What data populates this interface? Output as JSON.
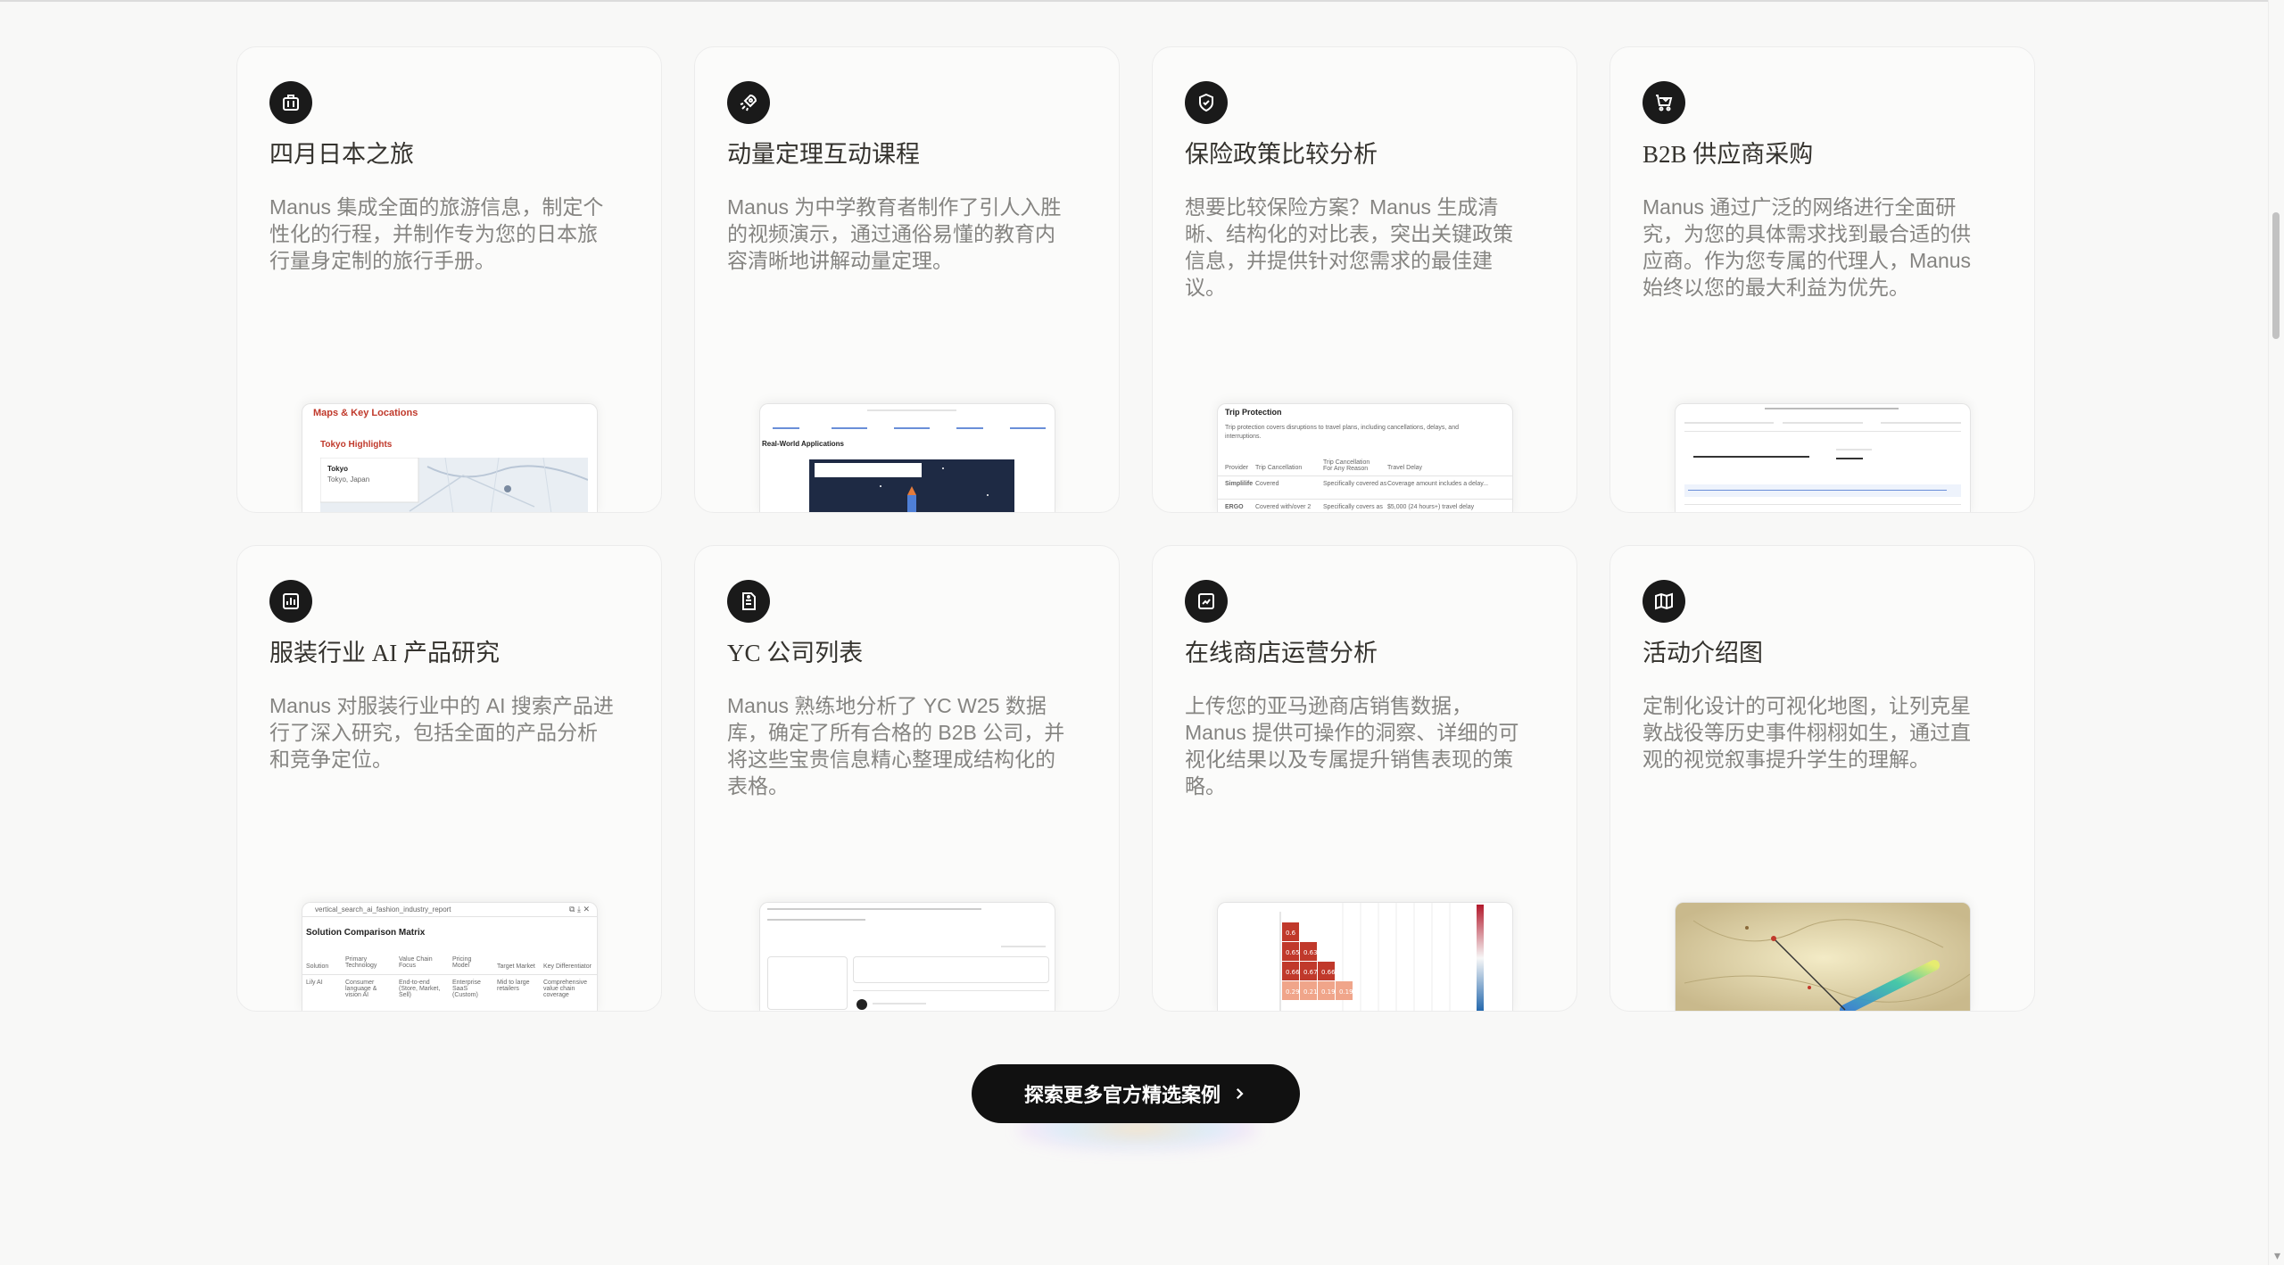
{
  "cards": [
    {
      "icon": "suitcase-icon",
      "title": "四月日本之旅",
      "desc": "Manus 集成全面的旅游信息，制定个性化的行程，并制作专为您的日本旅行量身定制的旅行手册。",
      "preview": {
        "heading": "Maps & Key Locations",
        "sub": "Tokyo Highlights",
        "place": "Tokyo",
        "place_sub": "Tokyo, Japan"
      }
    },
    {
      "icon": "rocket-icon",
      "title": "动量定理互动课程",
      "desc": "Manus 为中学教育者制作了引人入胜的视频演示，通过通俗易懂的教育内容清晰地讲解动量定理。",
      "preview": {
        "heading": "Real-World Applications"
      }
    },
    {
      "icon": "shield-icon",
      "title": "保险政策比较分析",
      "desc": "想要比较保险方案？Manus 生成清晰、结构化的对比表，突出关键政策信息，并提供针对您需求的最佳建议。",
      "preview": {
        "heading": "Trip Protection",
        "intro": "Trip protection covers disruptions to travel plans, including cancellations, delays, and interruptions.",
        "columns": [
          "Provider",
          "Trip Cancellation",
          "Trip Cancellation For Any Reason",
          "Travel Delay"
        ],
        "rows": [
          [
            "Simplilife",
            "Covered",
            "Specifically covered as",
            "Coverage amount includes a delay..."
          ],
          [
            "ERGO",
            "Covered with/over 2",
            "Specifically covers as",
            "$5,000 (24 hours+) travel delay"
          ]
        ]
      }
    },
    {
      "icon": "cart-icon",
      "title": "B2B 供应商采购",
      "desc": "Manus 通过广泛的网络进行全面研究，为您的具体需求找到最合适的供应商。作为您专属的代理人，Manus 始终以您的最大利益为优先。",
      "preview": {}
    },
    {
      "icon": "chart-icon",
      "title": "服装行业 AI 产品研究",
      "desc": "Manus 对服装行业中的 AI 搜索产品进行了深入研究，包括全面的产品分析和竞争定位。",
      "preview": {
        "file": "vertical_search_ai_fashion_industry_report",
        "heading": "Solution Comparison Matrix",
        "columns": [
          "Solution",
          "Primary Technology",
          "Value Chain Focus",
          "Pricing Model",
          "Target Market",
          "Key Differentiator"
        ],
        "rows": [
          [
            "Lily AI",
            "Consumer language & vision AI",
            "End-to-end (Store, Market, Sell)",
            "Enterprise SaaS (Custom)",
            "Mid to large retailers",
            "Comprehensive value chain coverage"
          ]
        ]
      }
    },
    {
      "icon": "document-icon",
      "title": "YC 公司列表",
      "desc": "Manus 熟练地分析了 YC W25 数据库，确定了所有合格的 B2B 公司，并将这些宝贵信息精心整理成结构化的表格。",
      "preview": {}
    },
    {
      "icon": "store-chart-icon",
      "title": "在线商店运营分析",
      "desc": "上传您的亚马逊商店销售数据，Manus 提供可操作的洞察、详细的可视化结果以及专属提升销售表现的策略。",
      "preview": {
        "heatmap": [
          [
            "0.6",
            "",
            "",
            ""
          ],
          [
            "0.65",
            "0.63",
            "",
            ""
          ],
          [
            "0.66",
            "0.67",
            "0.66",
            ""
          ],
          [
            "0.29",
            "0.21",
            "0.19",
            "0.19"
          ]
        ]
      }
    },
    {
      "icon": "map-icon",
      "title": "活动介绍图",
      "desc": "定制化设计的可视化地图，让列克星敦战役等历史事件栩栩如生，通过直观的视觉叙事提升学生的理解。",
      "preview": {}
    }
  ],
  "cta": {
    "label": "探索更多官方精选案例",
    "icon": "chevron-right-icon"
  },
  "colors": {
    "card_bg": "#fbfbfa",
    "badge_bg": "#1a1a1a",
    "cta_bg": "#111111",
    "accent_red": "#c0392b"
  }
}
